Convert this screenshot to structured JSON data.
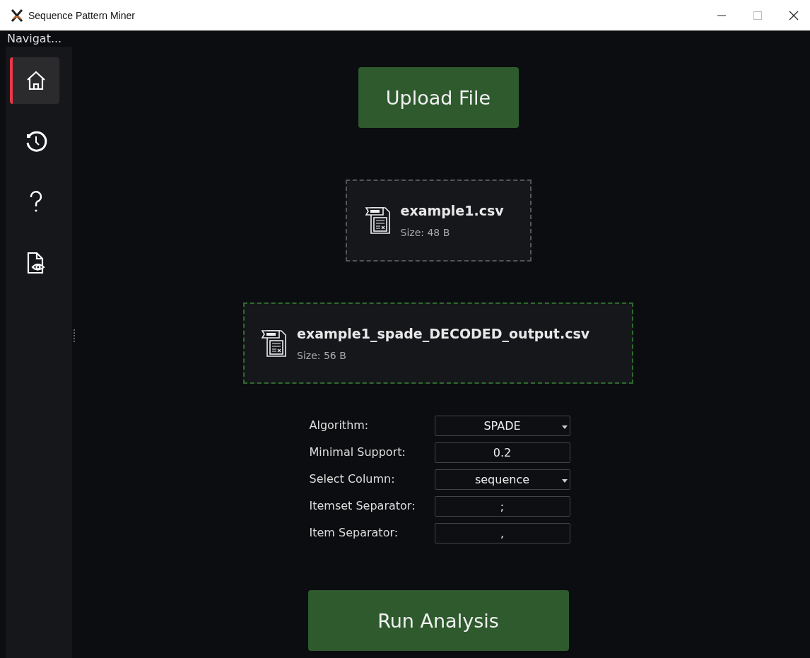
{
  "window": {
    "title": "Sequence Pattern Miner"
  },
  "sidebar": {
    "title": "Navigat...",
    "items": [
      {
        "kind": "home",
        "selected": true
      },
      {
        "kind": "history",
        "selected": false
      },
      {
        "kind": "help",
        "selected": false
      },
      {
        "kind": "preview",
        "selected": false
      }
    ]
  },
  "upload_button": "Upload File",
  "files": [
    {
      "kind": "input",
      "name": "example1.csv",
      "size": "Size: 48 B"
    },
    {
      "kind": "output",
      "name": "example1_spade_DECODED_output.csv",
      "size": "Size: 56 B"
    }
  ],
  "form": [
    {
      "label": "Algorithm:",
      "kind": "dropdown",
      "value": "SPADE"
    },
    {
      "label": "Minimal Support:",
      "kind": "text",
      "value": "0.2"
    },
    {
      "label": "Select Column:",
      "kind": "dropdown",
      "value": "sequence"
    },
    {
      "label": "Itemset Separator:",
      "kind": "text",
      "value": ";"
    },
    {
      "label": "Item Separator:",
      "kind": "text",
      "value": ","
    }
  ],
  "run_button": "Run Analysis"
}
